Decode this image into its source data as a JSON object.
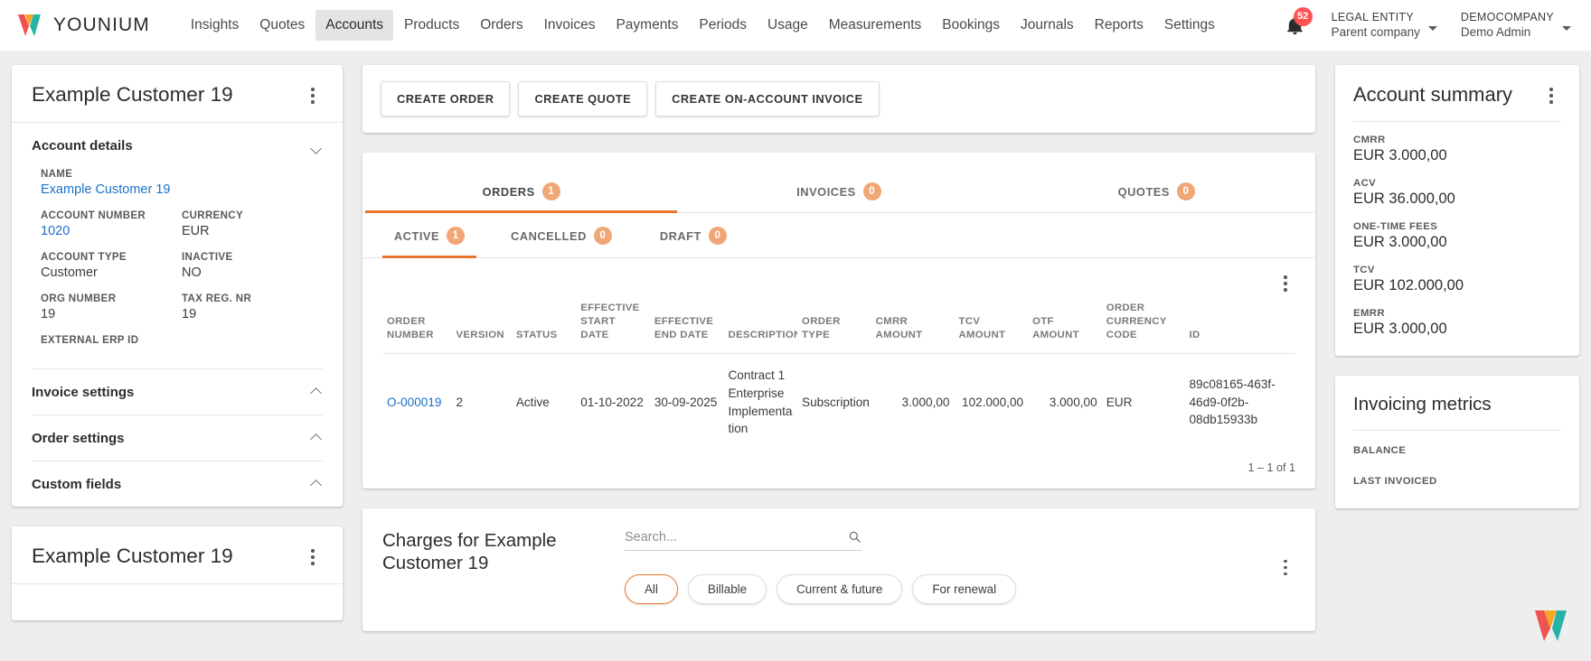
{
  "brand": {
    "name": "YOUNIUM",
    "accent": "#e8762c",
    "link_color": "#1a73c8",
    "badge_color": "#ff5252"
  },
  "topnav": {
    "items": [
      {
        "label": "Insights",
        "active": false
      },
      {
        "label": "Quotes",
        "active": false
      },
      {
        "label": "Accounts",
        "active": true
      },
      {
        "label": "Products",
        "active": false
      },
      {
        "label": "Orders",
        "active": false
      },
      {
        "label": "Invoices",
        "active": false
      },
      {
        "label": "Payments",
        "active": false
      },
      {
        "label": "Periods",
        "active": false
      },
      {
        "label": "Usage",
        "active": false
      },
      {
        "label": "Measurements",
        "active": false
      },
      {
        "label": "Bookings",
        "active": false
      },
      {
        "label": "Journals",
        "active": false
      },
      {
        "label": "Reports",
        "active": false
      },
      {
        "label": "Settings",
        "active": false
      }
    ],
    "notification_count": "52",
    "legal_entity": {
      "title": "LEGAL ENTITY",
      "subtitle": "Parent company"
    },
    "company": {
      "title": "DEMOCOMPANY",
      "subtitle": "Demo Admin"
    }
  },
  "account_card": {
    "title": "Example Customer 19",
    "sections": [
      {
        "label": "Account details",
        "expanded": true
      },
      {
        "label": "Invoice settings",
        "expanded": false
      },
      {
        "label": "Order settings",
        "expanded": false
      },
      {
        "label": "Custom fields",
        "expanded": false
      }
    ],
    "fields": [
      {
        "label": "NAME",
        "value": "Example Customer 19",
        "link": true
      },
      {
        "label": "ACCOUNT NUMBER",
        "value": "1020",
        "link": true
      },
      {
        "label": "CURRENCY",
        "value": "EUR",
        "link": false
      },
      {
        "label": "ACCOUNT TYPE",
        "value": "Customer",
        "link": false
      },
      {
        "label": "INACTIVE",
        "value": "NO",
        "link": false
      },
      {
        "label": "ORG NUMBER",
        "value": "19",
        "link": false
      },
      {
        "label": "TAX REG. NR",
        "value": "19",
        "link": false
      },
      {
        "label": "EXTERNAL ERP ID",
        "value": "",
        "link": false
      }
    ]
  },
  "second_card": {
    "title": "Example Customer 19"
  },
  "actions": {
    "create_order": "CREATE ORDER",
    "create_quote": "CREATE QUOTE",
    "create_on_account_invoice": "CREATE ON-ACCOUNT INVOICE"
  },
  "main_tabs": [
    {
      "label": "ORDERS",
      "count": "1",
      "selected": true
    },
    {
      "label": "INVOICES",
      "count": "0",
      "selected": false
    },
    {
      "label": "QUOTES",
      "count": "0",
      "selected": false
    }
  ],
  "sub_tabs": [
    {
      "label": "ACTIVE",
      "count": "1",
      "selected": true
    },
    {
      "label": "CANCELLED",
      "count": "0",
      "selected": false
    },
    {
      "label": "DRAFT",
      "count": "0",
      "selected": false
    }
  ],
  "orders_table": {
    "columns": [
      "ORDER NUMBER",
      "VERSION",
      "STATUS",
      "EFFECTIVE START DATE",
      "EFFECTIVE END DATE",
      "DESCRIPTION",
      "ORDER TYPE",
      "CMRR AMOUNT",
      "TCV AMOUNT",
      "OTF AMOUNT",
      "ORDER CURRENCY CODE",
      "ID"
    ],
    "rows": [
      {
        "order_number": "O-000019",
        "version": "2",
        "status": "Active",
        "effective_start_date": "01-10-2022",
        "effective_end_date": "30-09-2025",
        "description": "Contract 1 Enterprise Implementation",
        "order_type": "Subscription",
        "cmrr_amount": "3.000,00",
        "tcv_amount": "102.000,00",
        "otf_amount": "3.000,00",
        "order_currency_code": "EUR",
        "id": "89c08165-463f-46d9-0f2b-08db15933b"
      }
    ],
    "pager": "1 – 1 of 1"
  },
  "charges": {
    "title": "Charges for Example Customer 19",
    "search_placeholder": "Search...",
    "search_value": "",
    "filters": [
      {
        "label": "All",
        "selected": true
      },
      {
        "label": "Billable",
        "selected": false
      },
      {
        "label": "Current & future",
        "selected": false
      },
      {
        "label": "For renewal",
        "selected": false
      }
    ]
  },
  "account_summary": {
    "title": "Account summary",
    "items": [
      {
        "label": "CMRR",
        "value": "EUR 3.000,00"
      },
      {
        "label": "ACV",
        "value": "EUR 36.000,00"
      },
      {
        "label": "ONE-TIME FEES",
        "value": "EUR 3.000,00"
      },
      {
        "label": "TCV",
        "value": "EUR 102.000,00"
      },
      {
        "label": "EMRR",
        "value": "EUR 3.000,00"
      }
    ]
  },
  "invoicing_metrics": {
    "title": "Invoicing metrics",
    "items": [
      {
        "label": "BALANCE"
      },
      {
        "label": "LAST INVOICED"
      }
    ]
  }
}
